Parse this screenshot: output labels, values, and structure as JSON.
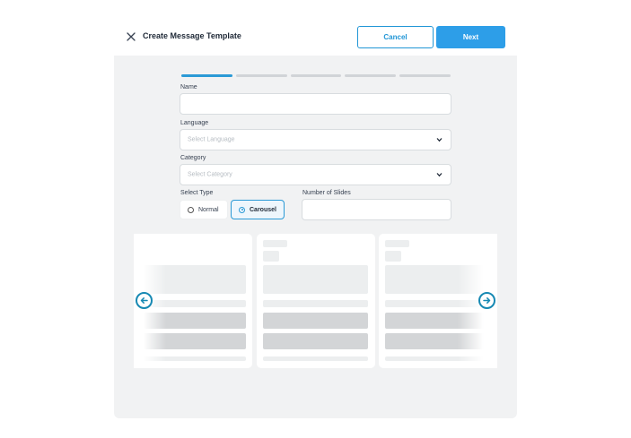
{
  "header": {
    "title": "Create Message Template",
    "cancel_label": "Cancel",
    "next_label": "Next"
  },
  "stepper": {
    "total_steps": 5,
    "current_step": 1
  },
  "form": {
    "name": {
      "label": "Name",
      "value": ""
    },
    "language": {
      "label": "Language",
      "placeholder": "Select Language"
    },
    "category": {
      "label": "Category",
      "placeholder": "Select Category"
    },
    "select_type": {
      "label": "Select Type",
      "options": [
        "Normal",
        "Carousel"
      ],
      "selected": "Carousel"
    },
    "number_of_slides": {
      "label": "Number of Slides",
      "value": ""
    }
  },
  "carousel": {
    "slide_count_visible": 3
  },
  "colors": {
    "accent": "#2d9ee8",
    "accent_border": "#2196d6",
    "arrow": "#1789b3",
    "panel_bg": "#f1f2f3"
  },
  "icons": {
    "close": "close-icon",
    "dropdown": "chevron-down-icon",
    "prev": "arrow-left-circle-icon",
    "next": "arrow-right-circle-icon"
  }
}
